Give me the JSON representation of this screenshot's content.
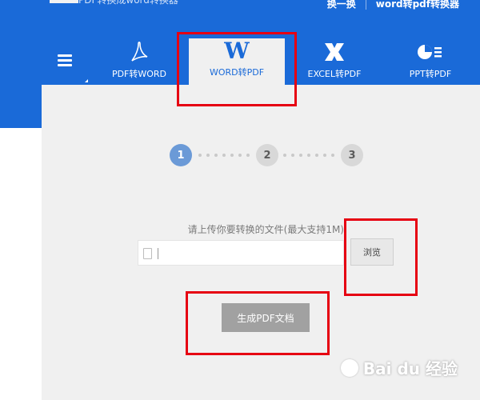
{
  "header": {
    "title_fragment": "PDF转换成word转换器",
    "links": [
      "换一换",
      "word转pdf转换器"
    ]
  },
  "tabs": [
    {
      "label": "PDF转WORD",
      "icon": "acrobat-icon"
    },
    {
      "label": "WORD转PDF",
      "icon": "word-w-icon",
      "icon_text": "W",
      "active": true
    },
    {
      "label": "EXCEL转PDF",
      "icon": "excel-x-icon"
    },
    {
      "label": "PPT转PDF",
      "icon": "ppt-chart-icon"
    }
  ],
  "steps": [
    "1",
    "2",
    "3"
  ],
  "upload": {
    "label": "请上传你要转换的文件(最大支持1M)",
    "input_value": "",
    "browse_label": "浏览"
  },
  "generate_label": "生成PDF文档",
  "watermark": {
    "text": "Bai du 经验"
  },
  "colors": {
    "header_bg": "#1a6ad8",
    "highlight": "#e60012",
    "content_bg": "#f0f0f0",
    "active_step": "#6b9ad7"
  }
}
